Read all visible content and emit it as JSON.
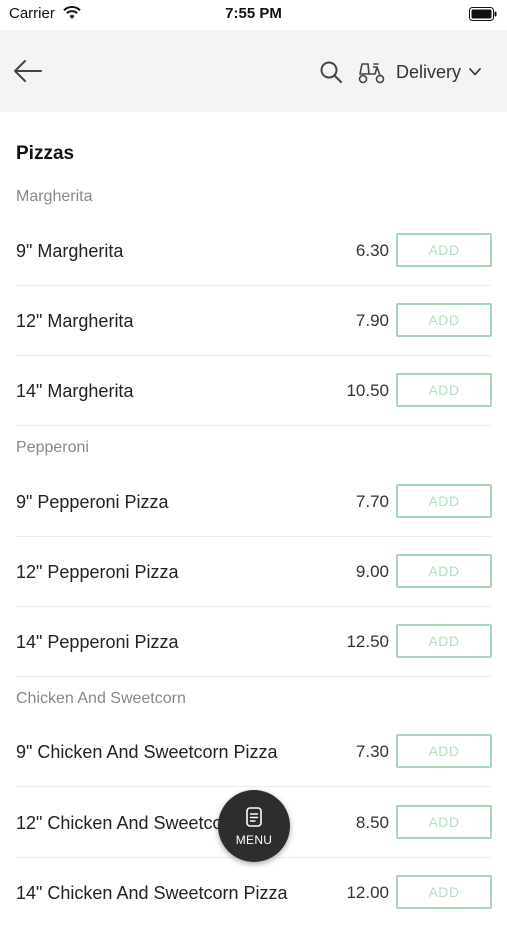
{
  "status_bar": {
    "carrier": "Carrier",
    "time": "7:55 PM"
  },
  "header": {
    "mode_label": "Delivery"
  },
  "menu": {
    "section_title": "Pizzas",
    "categories": [
      {
        "name": "Margherita",
        "items": [
          {
            "name": "9\" Margherita",
            "price": "6.30",
            "add_label": "ADD"
          },
          {
            "name": "12\" Margherita",
            "price": "7.90",
            "add_label": "ADD"
          },
          {
            "name": "14\" Margherita",
            "price": "10.50",
            "add_label": "ADD"
          }
        ]
      },
      {
        "name": "Pepperoni",
        "items": [
          {
            "name": "9\" Pepperoni Pizza",
            "price": "7.70",
            "add_label": "ADD"
          },
          {
            "name": "12\" Pepperoni Pizza",
            "price": "9.00",
            "add_label": "ADD"
          },
          {
            "name": "14\" Pepperoni Pizza",
            "price": "12.50",
            "add_label": "ADD"
          }
        ]
      },
      {
        "name": "Chicken And Sweetcorn",
        "items": [
          {
            "name": "9\" Chicken And Sweetcorn  Pizza",
            "price": "7.30",
            "add_label": "ADD"
          },
          {
            "name": "12\" Chicken And Sweetcorn  Pizza",
            "price": "8.50",
            "add_label": "ADD"
          },
          {
            "name": "14\" Chicken And Sweetcorn Pizza",
            "price": "12.00",
            "add_label": "ADD"
          }
        ]
      }
    ]
  },
  "fab": {
    "label": "MENU"
  },
  "colors": {
    "add_border": "#a9d6b7",
    "fab_bg": "#2d2d2d",
    "header_bg": "#f4f4f4"
  },
  "icons": {
    "back": "arrow-left-icon",
    "search": "search-icon",
    "delivery": "scooter-icon",
    "dropdown": "chevron-down-icon",
    "menu": "menu-icon"
  }
}
